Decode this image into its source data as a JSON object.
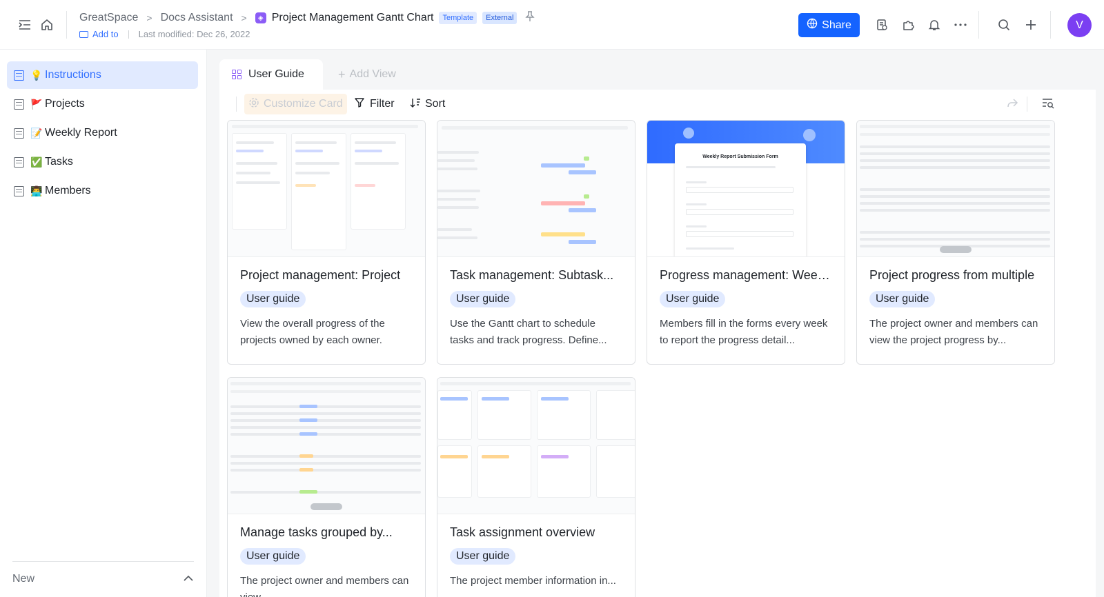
{
  "header": {
    "breadcrumb": [
      "GreatSpace",
      "Docs Assistant"
    ],
    "doc_title": "Project Management Gantt Chart",
    "tag_template": "Template",
    "tag_external": "External",
    "add_to": "Add to",
    "last_modified": "Last modified: Dec 26, 2022",
    "share_label": "Share",
    "avatar_letter": "V"
  },
  "sidebar": {
    "items": [
      {
        "emoji": "💡",
        "label": "Instructions",
        "active": true
      },
      {
        "emoji": "🚩",
        "label": "Projects"
      },
      {
        "emoji": "📝",
        "label": "Weekly Report"
      },
      {
        "emoji": "✅",
        "label": "Tasks"
      },
      {
        "emoji": "👨‍💻",
        "label": "Members"
      }
    ],
    "new_label": "New"
  },
  "tabs": {
    "active": "User Guide",
    "add_view": "Add View"
  },
  "toolbar": {
    "customize": "Customize Card",
    "filter": "Filter",
    "sort": "Sort"
  },
  "cards": [
    {
      "title": "Project management: Project",
      "tag": "User guide",
      "desc": "View the overall progress of the projects owned by each owner."
    },
    {
      "title": "Task management: Subtask...",
      "tag": "User guide",
      "desc": "Use the Gantt chart to schedule tasks and track progress. Define..."
    },
    {
      "title": "Progress management: Weekly",
      "tag": "User guide",
      "desc": "Members fill in the forms every week to report the progress detail..."
    },
    {
      "title": "Project progress from multiple",
      "tag": "User guide",
      "desc": "The project owner and members can view the project progress by..."
    },
    {
      "title": "Manage tasks grouped by...",
      "tag": "User guide",
      "desc": "The project owner and members can view..."
    },
    {
      "title": "Task assignment overview",
      "tag": "User guide",
      "desc": "The project member information in..."
    }
  ],
  "form_mock": {
    "title": "Weekly Report Submission Form"
  },
  "colors": {
    "accent": "#3370ff",
    "share_bg": "#1463ff",
    "avatar_bg": "#7b3ff2"
  }
}
